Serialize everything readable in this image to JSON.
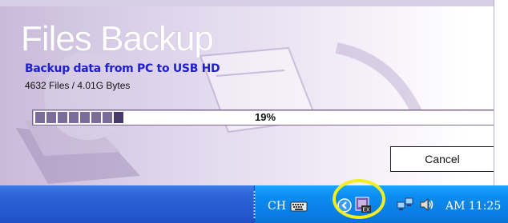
{
  "dialog": {
    "app_title": "Files Backup",
    "subtitle": "Backup data from PC to USB HD",
    "file_count": "4632 Files / 4.01G Bytes",
    "progress_percent_label": "19%",
    "progress_fraction": 0.19,
    "cancel_label": "Cancel"
  },
  "taskbar": {
    "language": "CH",
    "clock": "AM 11:25",
    "tray_icons": [
      "keyboard-icon",
      "show-hidden-icons-chevron",
      "files-backup-tray-icon",
      "network-icon",
      "speaker-icon"
    ]
  },
  "colors": {
    "subtitle": "#1f1fcc",
    "taskbar": "#2558cf",
    "tray": "#0c8cf0",
    "highlight": "#f3ee22"
  }
}
